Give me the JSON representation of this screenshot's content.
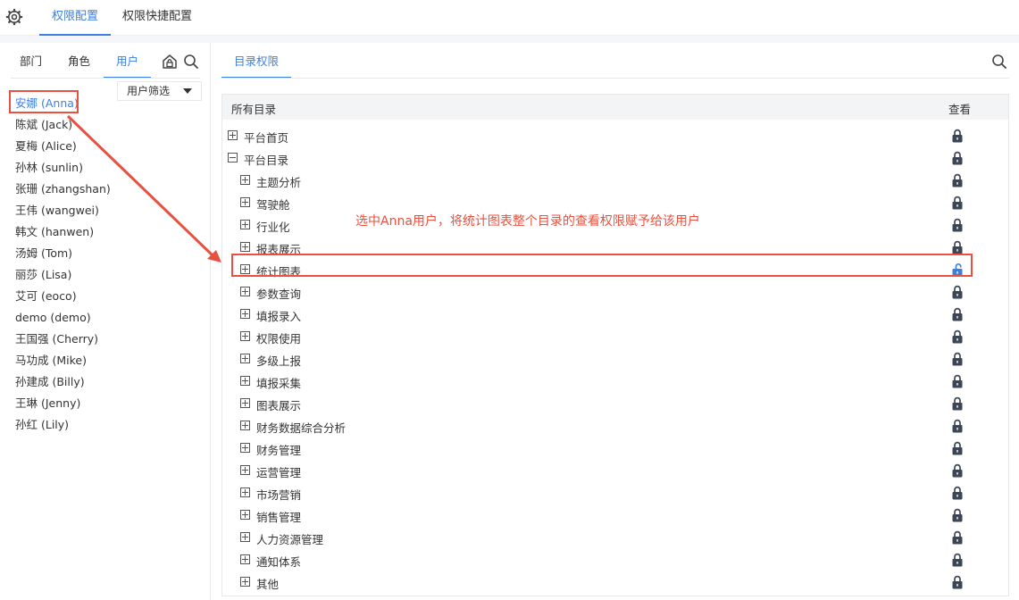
{
  "topbar": {
    "tabs": [
      {
        "label": "权限配置",
        "active": true
      },
      {
        "label": "权限快捷配置",
        "active": false
      }
    ]
  },
  "left": {
    "tabs": [
      {
        "label": "部门",
        "active": false
      },
      {
        "label": "角色",
        "active": false
      },
      {
        "label": "用户",
        "active": true
      }
    ],
    "filter_label": "用户筛选",
    "users": [
      "安娜 (Anna)",
      "陈斌 (Jack)",
      "夏梅 (Alice)",
      "孙林 (sunlin)",
      "张珊 (zhangshan)",
      "王伟 (wangwei)",
      "韩文 (hanwen)",
      "汤姆 (Tom)",
      "丽莎 (Lisa)",
      "艾可 (eoco)",
      "demo (demo)",
      "王国强 (Cherry)",
      "马功成 (Mike)",
      "孙建成 (Billy)",
      "王琳 (Jenny)",
      "孙红 (Lily)"
    ],
    "selected_user": "安娜 (Anna)"
  },
  "right": {
    "tab_label": "目录权限",
    "header": {
      "col_catalog": "所有目录",
      "col_view": "查看"
    },
    "rows": [
      {
        "label": "平台首页",
        "level": 0,
        "expanded": false,
        "view": "locked"
      },
      {
        "label": "平台目录",
        "level": 0,
        "expanded": true,
        "view": "locked"
      },
      {
        "label": "主题分析",
        "level": 1,
        "expanded": false,
        "view": "locked"
      },
      {
        "label": "驾驶舱",
        "level": 1,
        "expanded": false,
        "view": "locked"
      },
      {
        "label": "行业化",
        "level": 1,
        "expanded": false,
        "view": "locked"
      },
      {
        "label": "报表展示",
        "level": 1,
        "expanded": false,
        "view": "locked"
      },
      {
        "label": "统计图表",
        "level": 1,
        "expanded": false,
        "view": "unlocked"
      },
      {
        "label": "参数查询",
        "level": 1,
        "expanded": false,
        "view": "locked"
      },
      {
        "label": "填报录入",
        "level": 1,
        "expanded": false,
        "view": "locked"
      },
      {
        "label": "权限使用",
        "level": 1,
        "expanded": false,
        "view": "locked"
      },
      {
        "label": "多级上报",
        "level": 1,
        "expanded": false,
        "view": "locked"
      },
      {
        "label": "填报采集",
        "level": 1,
        "expanded": false,
        "view": "locked"
      },
      {
        "label": "图表展示",
        "level": 1,
        "expanded": false,
        "view": "locked"
      },
      {
        "label": "财务数据综合分析",
        "level": 1,
        "expanded": false,
        "view": "locked"
      },
      {
        "label": "财务管理",
        "level": 1,
        "expanded": false,
        "view": "locked"
      },
      {
        "label": "运营管理",
        "level": 1,
        "expanded": false,
        "view": "locked"
      },
      {
        "label": "市场营销",
        "level": 1,
        "expanded": false,
        "view": "locked"
      },
      {
        "label": "销售管理",
        "level": 1,
        "expanded": false,
        "view": "locked"
      },
      {
        "label": "人力资源管理",
        "level": 1,
        "expanded": false,
        "view": "locked"
      },
      {
        "label": "通知体系",
        "level": 1,
        "expanded": false,
        "view": "locked"
      },
      {
        "label": "其他",
        "level": 1,
        "expanded": false,
        "view": "locked"
      }
    ]
  },
  "annotation": {
    "note": "选中Anna用户，将统计图表整个目录的查看权限赋予给该用户"
  },
  "colors": {
    "accent": "#3b7fe0",
    "annotation": "#e8513f",
    "lock": "#3c4554"
  },
  "icons": {
    "settings": "gear-icon",
    "manage": "house-lock-icon",
    "search": "search-icon",
    "locked": "lock-icon",
    "unlocked": "unlock-icon"
  }
}
